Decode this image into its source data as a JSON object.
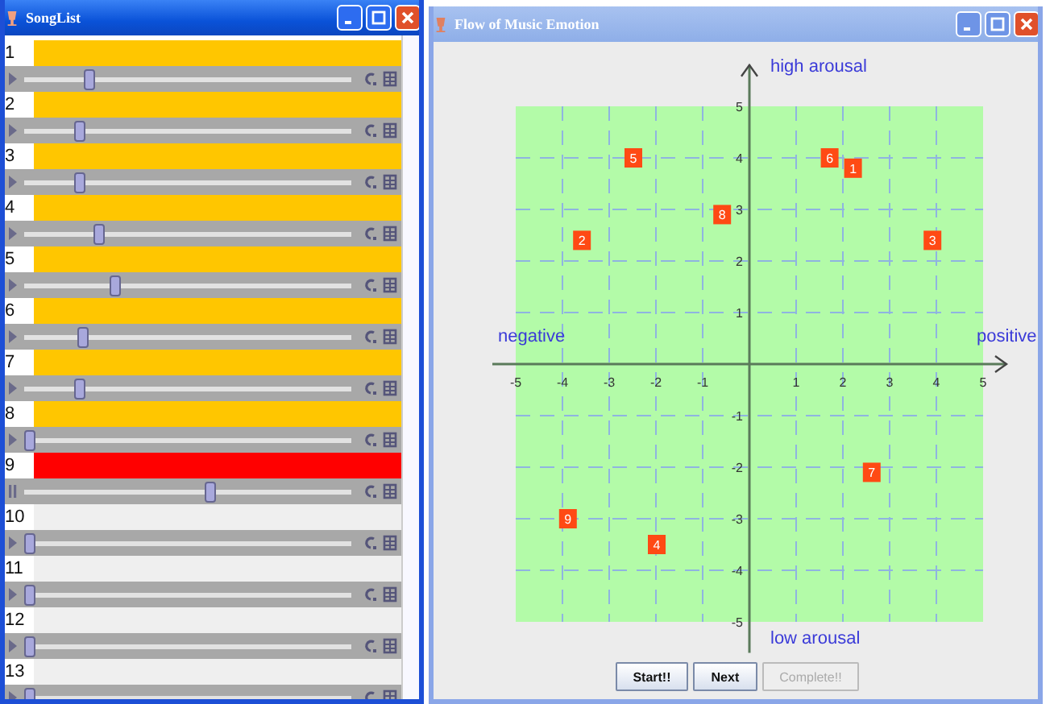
{
  "songlist": {
    "title": "SongList",
    "songs": [
      {
        "number": "1",
        "color": "#ffc600",
        "playing": false,
        "level": 0.19
      },
      {
        "number": "2",
        "color": "#ffc600",
        "playing": false,
        "level": 0.16
      },
      {
        "number": "3",
        "color": "#ffc600",
        "playing": false,
        "level": 0.16
      },
      {
        "number": "4",
        "color": "#ffc600",
        "playing": false,
        "level": 0.22
      },
      {
        "number": "5",
        "color": "#ffc600",
        "playing": false,
        "level": 0.27
      },
      {
        "number": "6",
        "color": "#ffc600",
        "playing": false,
        "level": 0.17
      },
      {
        "number": "7",
        "color": "#ffc600",
        "playing": false,
        "level": 0.16
      },
      {
        "number": "8",
        "color": "#ffc600",
        "playing": false,
        "level": 0
      },
      {
        "number": "9",
        "color": "#ff0000",
        "playing": true,
        "level": 0.57
      },
      {
        "number": "10",
        "color": "#efefef",
        "playing": false,
        "level": 0
      },
      {
        "number": "11",
        "color": "#efefef",
        "playing": false,
        "level": 0
      },
      {
        "number": "12",
        "color": "#efefef",
        "playing": false,
        "level": 0
      },
      {
        "number": "13",
        "color": "#efefef",
        "playing": false,
        "level": 0
      }
    ]
  },
  "emotion_window": {
    "title": "Flow of Music Emotion",
    "axis_labels": {
      "top": "high arousal",
      "bottom": "low arousal",
      "left": "negative",
      "right": "positive"
    },
    "chart_data": {
      "type": "scatter",
      "grid": true,
      "xlim": [
        -5,
        5
      ],
      "ylim": [
        -5,
        5
      ],
      "xticks": [
        -5,
        -4,
        -3,
        -2,
        -1,
        1,
        2,
        3,
        4,
        5
      ],
      "yticks": [
        -5,
        -4,
        -3,
        -2,
        -1,
        1,
        2,
        3,
        4,
        5
      ],
      "x": [
        2.2,
        -3.6,
        3.9,
        -2,
        -2.5,
        1.7,
        2.6,
        -0.6,
        -3.9
      ],
      "series": [
        {
          "color": "#ff4a14",
          "values": [
            3.8,
            2.4,
            2.4,
            -3.5,
            4,
            4,
            -2.1,
            2.9,
            -3
          ]
        }
      ],
      "value_labels": [
        "1",
        "2",
        "3",
        "4",
        "5",
        "6",
        "7",
        "8",
        "9"
      ]
    },
    "buttons": [
      {
        "label": "Start!!",
        "disabled": false
      },
      {
        "label": "Next",
        "disabled": false
      },
      {
        "label": "Complete!!",
        "disabled": true
      }
    ]
  }
}
